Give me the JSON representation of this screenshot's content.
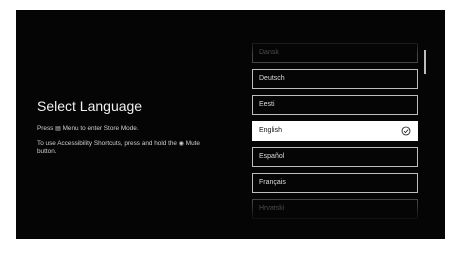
{
  "title": "Select Language",
  "instructions": {
    "line1_before": "Press ",
    "line1_after": " Menu to enter Store Mode.",
    "line2_before": "To use Accessibility Shortcuts, press and hold the ",
    "line2_after": " Mute button.",
    "menu_icon": "menu-icon",
    "mute_icon": "mute-icon"
  },
  "languages": [
    {
      "label": "Dansk"
    },
    {
      "label": "Deutsch"
    },
    {
      "label": "Eesti"
    },
    {
      "label": "English",
      "selected": true
    },
    {
      "label": "Español"
    },
    {
      "label": "Français"
    },
    {
      "label": "Hrvatski"
    }
  ],
  "selected_language": "English",
  "icons": {
    "selected_indicator": "check-circle-icon"
  },
  "colors": {
    "background": "#050505",
    "selected_bg": "#ffffff",
    "border": "#bdbdbd"
  }
}
